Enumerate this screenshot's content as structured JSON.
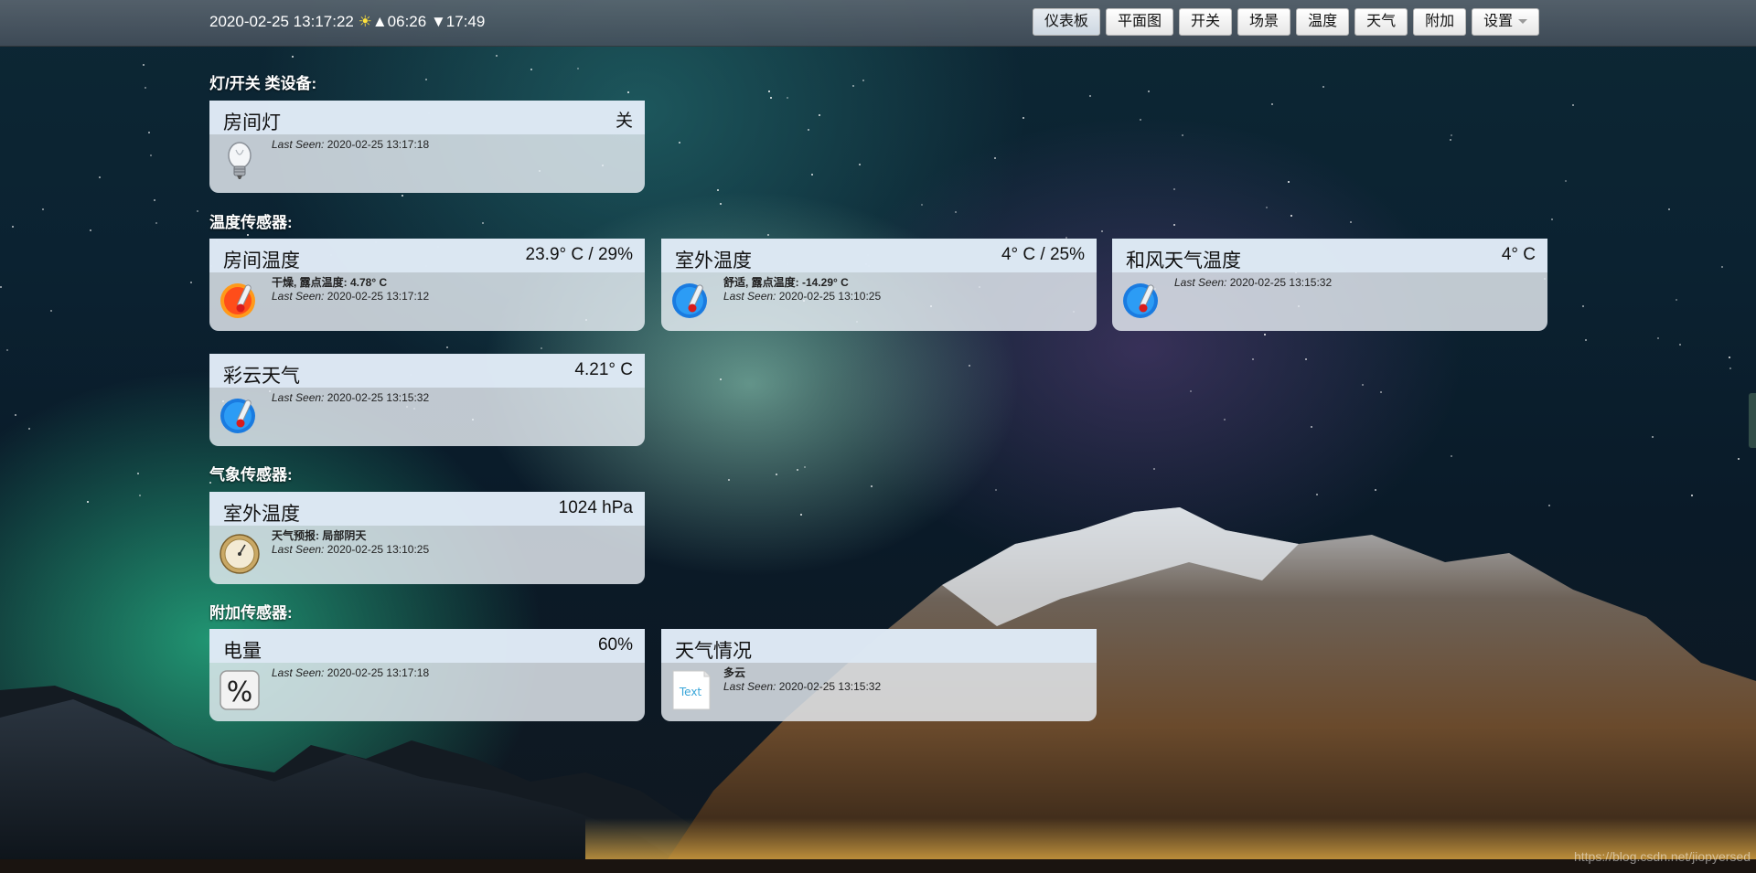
{
  "header": {
    "datetime": "2020-02-25 13:17:22",
    "sunrise": "▲06:26",
    "sunset": "▼17:49",
    "nav": [
      "仪表板",
      "平面图",
      "开关",
      "场景",
      "温度",
      "天气",
      "附加",
      "设置"
    ]
  },
  "sections": {
    "switches": "灯/开关 类设备:",
    "temperature": "温度传感器:",
    "weather": "气象传感器:",
    "utility": "附加传感器:"
  },
  "labels": {
    "last_seen": "Last Seen:"
  },
  "devices": {
    "room_light": {
      "name": "房间灯",
      "value": "关",
      "detail": "",
      "last_seen": "2020-02-25 13:17:18",
      "icon": "lightbulb-icon"
    },
    "room_temp": {
      "name": "房间温度",
      "value": "23.9° C / 29%",
      "detail": "干燥, 露点温度: 4.78° C",
      "last_seen": "2020-02-25 13:17:12",
      "icon": "thermometer-hot-icon"
    },
    "outdoor_temp": {
      "name": "室外温度",
      "value": "4° C / 25%",
      "detail": "舒适, 露点温度: -14.29° C",
      "last_seen": "2020-02-25 13:10:25",
      "icon": "thermometer-cold-icon"
    },
    "hefeng_temp": {
      "name": "和风天气温度",
      "value": "4° C",
      "detail": "",
      "last_seen": "2020-02-25 13:15:32",
      "icon": "thermometer-cold-icon"
    },
    "caiyun": {
      "name": "彩云天气",
      "value": "4.21° C",
      "detail": "",
      "last_seen": "2020-02-25 13:15:32",
      "icon": "thermometer-cold-icon"
    },
    "outdoor_baro": {
      "name": "室外温度",
      "value": "1024 hPa",
      "detail": "天气预报: 局部阴天",
      "last_seen": "2020-02-25 13:10:25",
      "icon": "barometer-icon"
    },
    "battery": {
      "name": "电量",
      "value": "60%",
      "detail": "",
      "last_seen": "2020-02-25 13:17:18",
      "icon": "percent-icon"
    },
    "weather_text": {
      "name": "天气情况",
      "value": "",
      "detail": "多云",
      "last_seen": "2020-02-25 13:15:32",
      "icon": "text-icon"
    }
  },
  "watermark": "https://blog.csdn.net/jiopyersed",
  "colors": {
    "card_head": "#dce8f3",
    "accent_sun": "#ffe23b"
  }
}
